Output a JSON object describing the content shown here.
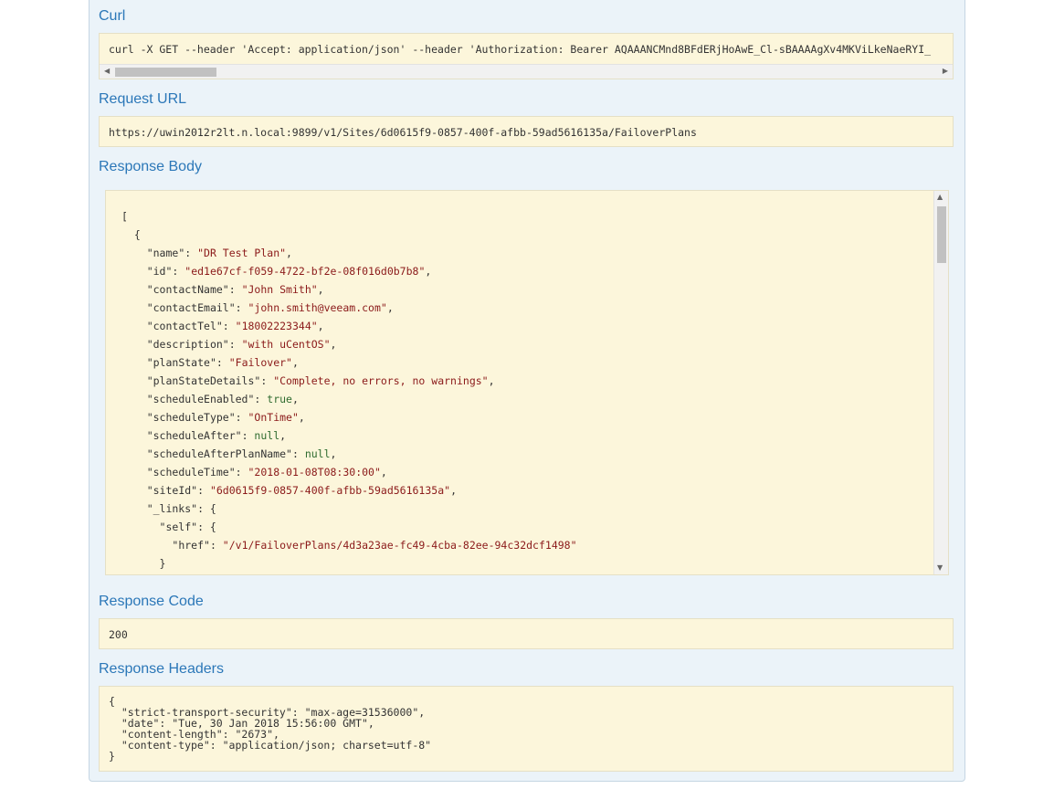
{
  "sections": {
    "curl_label": "Curl",
    "request_url_label": "Request URL",
    "response_body_label": "Response Body",
    "response_code_label": "Response Code",
    "response_headers_label": "Response Headers"
  },
  "curl": {
    "command": "curl -X GET --header 'Accept: application/json' --header 'Authorization: Bearer AQAAANCMnd8BFdERjHoAwE_Cl-sBAAAAgXv4MKViLkeNaeRYI_"
  },
  "request_url": "https://uwin2012r2lt.n.local:9899/v1/Sites/6d0615f9-0857-400f-afbb-59ad5616135a/FailoverPlans",
  "response_body": {
    "lines": [
      "[",
      "  {",
      "    \"name\": \"DR Test Plan\",",
      "    \"id\": \"ed1e67cf-f059-4722-bf2e-08f016d0b7b8\",",
      "    \"contactName\": \"John Smith\",",
      "    \"contactEmail\": \"john.smith@veeam.com\",",
      "    \"contactTel\": \"18002223344\",",
      "    \"description\": \"with uCentOS\",",
      "    \"planState\": \"Failover\",",
      "    \"planStateDetails\": \"Complete, no errors, no warnings\",",
      "    \"scheduleEnabled\": true,",
      "    \"scheduleType\": \"OnTime\",",
      "    \"scheduleAfter\": null,",
      "    \"scheduleAfterPlanName\": null,",
      "    \"scheduleTime\": \"2018-01-08T08:30:00\",",
      "    \"siteId\": \"6d0615f9-0857-400f-afbb-59ad5616135a\",",
      "    \"_links\": {",
      "      \"self\": {",
      "        \"href\": \"/v1/FailoverPlans/4d3a23ae-fc49-4cba-82ee-94c32dcf1498\"",
      "      }"
    ]
  },
  "response_code": "200",
  "response_headers": {
    "text": "{\n  \"strict-transport-security\": \"max-age=31536000\",\n  \"date\": \"Tue, 30 Jan 2018 15:56:00 GMT\",\n  \"content-length\": \"2673\",\n  \"content-type\": \"application/json; charset=utf-8\"\n}"
  },
  "colors": {
    "label": "#2b77b8",
    "code_bg": "#fcf6db",
    "panel_bg": "#ebf3f9",
    "json_string": "#8b1a1a",
    "json_literal": "#2f6b2f"
  },
  "icons": {
    "scroll_left": "triangle-left",
    "scroll_right": "triangle-right",
    "scroll_up": "triangle-up",
    "scroll_down": "triangle-down"
  }
}
